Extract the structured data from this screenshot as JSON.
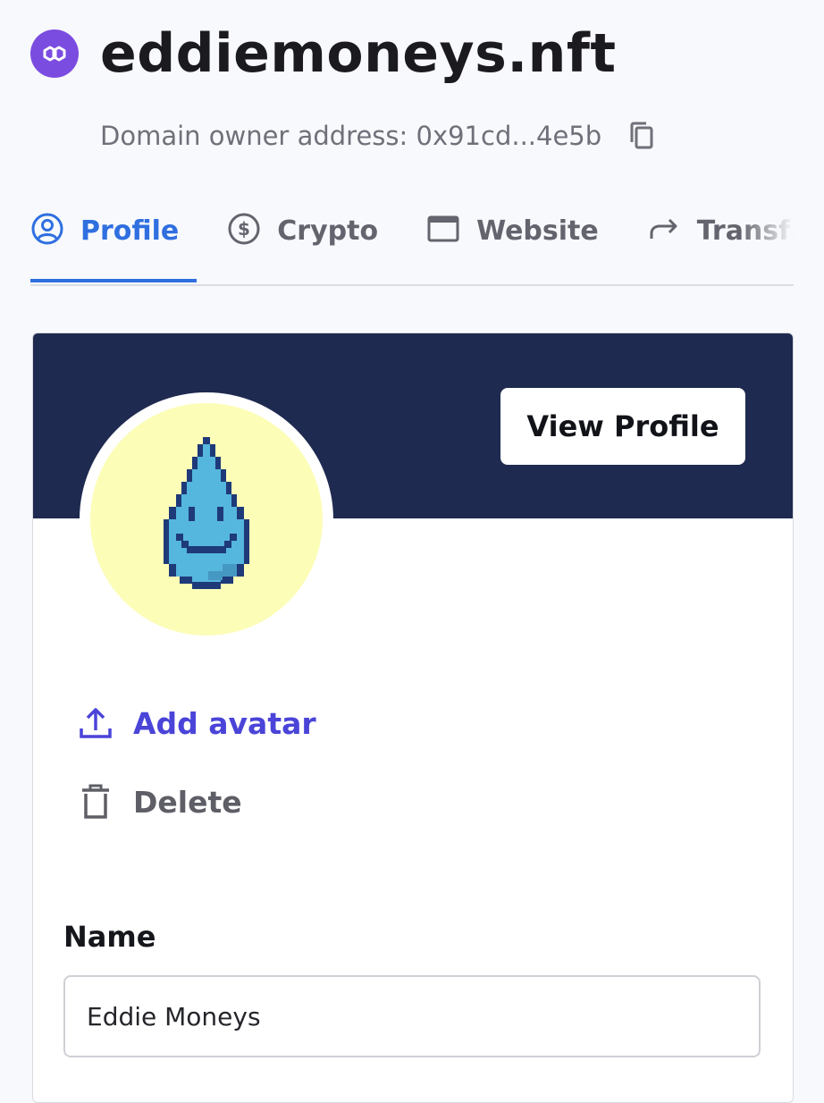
{
  "header": {
    "chain_icon": "polygon-icon",
    "domain": "eddiemoneys.nft",
    "owner_label": "Domain owner address: 0x91cd...4e5b",
    "copy_icon": "copy-icon"
  },
  "tabs": [
    {
      "label": "Profile",
      "icon": "user-circle-icon",
      "active": true
    },
    {
      "label": "Crypto",
      "icon": "dollar-circle-icon",
      "active": false
    },
    {
      "label": "Website",
      "icon": "browser-window-icon",
      "active": false
    },
    {
      "label": "Transfer",
      "icon": "share-arrow-icon",
      "active": false
    }
  ],
  "profile": {
    "view_profile_label": "View Profile",
    "avatar_icon": "pixel-water-drop-avatar",
    "add_avatar_label": "Add avatar",
    "delete_label": "Delete",
    "name_label": "Name",
    "name_value": "Eddie Moneys"
  },
  "colors": {
    "accent": "#2f6fe0",
    "add_avatar": "#4a44d8",
    "banner": "#1e2a4f",
    "polygon_badge": "#7b4ce0",
    "avatar_bg": "#fcfdb7"
  }
}
